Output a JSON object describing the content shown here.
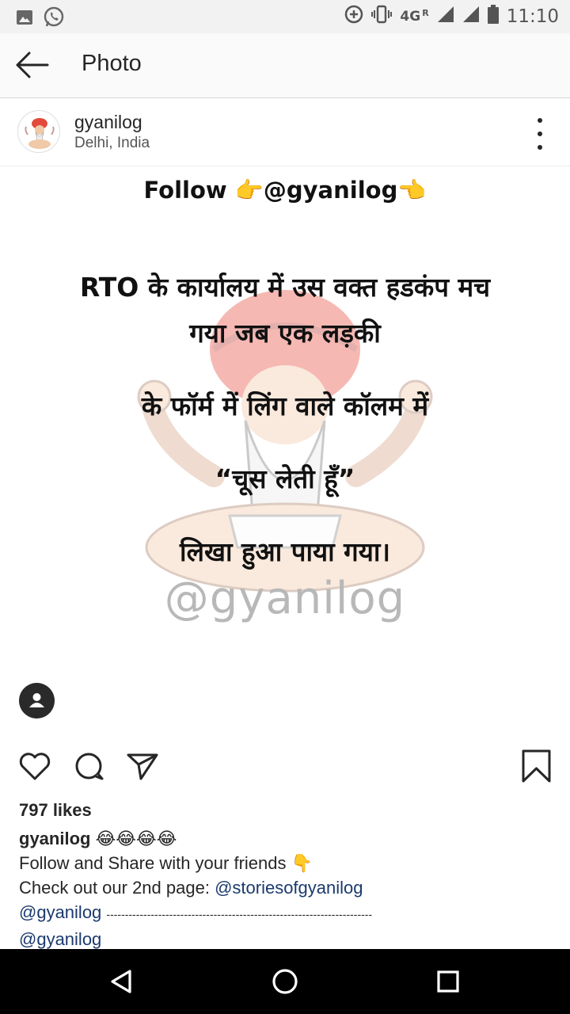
{
  "status_bar": {
    "left_icons": [
      "gallery-icon",
      "whatsapp-icon"
    ],
    "right_icons": [
      "data-saver-icon",
      "vibrate-icon",
      "signal-icon",
      "signal-icon",
      "battery-icon"
    ],
    "network": "4G",
    "roaming": "R",
    "time": "11:10"
  },
  "app_bar": {
    "back_icon": "arrow-left-icon",
    "title": "Photo"
  },
  "post": {
    "username": "gyanilog",
    "location": "Delhi, India",
    "more_icon": "more-vertical-icon",
    "image": {
      "follow_text": "Follow 👉@gyanilog👈",
      "lines": [
        "RTO के कार्यालय में उस वक्त हडकंप मच",
        "गया जब एक लड़की",
        "के फॉर्म में लिंग वाले कॉलम में",
        "“चूस लेती हूँ”",
        "लिखा हुआ पाया गया।"
      ],
      "watermark": "@gyanilog"
    },
    "actions": {
      "like_icon": "heart-icon",
      "comment_icon": "comment-icon",
      "share_icon": "send-icon",
      "save_icon": "bookmark-icon",
      "tag_icon": "person-tag-icon"
    },
    "likes": "797 likes",
    "caption": {
      "user": "gyanilog",
      "emojis": "😂😂😂😂",
      "line2": "Follow and Share with your friends 👇",
      "line3_prefix": "Check out our 2nd page: ",
      "line3_link": "@storiesofgyanilog",
      "line4_link": "@gyanilog",
      "line4_dashes": "------------------------------------------------------------------------",
      "line5_link": "@gyanilog"
    }
  },
  "nav_bar": {
    "back": "nav-back-icon",
    "home": "nav-home-icon",
    "recents": "nav-recents-icon"
  }
}
